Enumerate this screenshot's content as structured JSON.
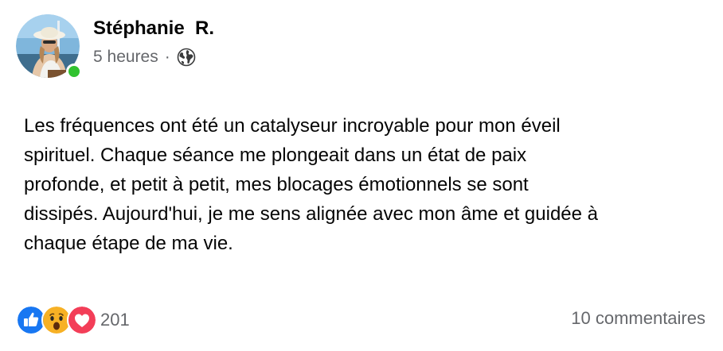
{
  "author": {
    "name": "Stéphanie  R.",
    "online": true
  },
  "meta": {
    "time": "5 heures",
    "separator": "·",
    "audience_icon": "globe-icon"
  },
  "post": {
    "lines": [
      "Les fréquences ont été un catalyseur incroyable pour mon éveil",
      "spirituel. Chaque séance me plongeait dans un état de paix",
      "profonde, et petit à petit, mes blocages émotionnels se sont",
      "dissipés. Aujourd'hui, je me sens alignée avec mon âme et guidée à",
      "chaque étape de ma vie."
    ]
  },
  "footer": {
    "reactions": [
      "like-icon",
      "wow-icon",
      "love-icon"
    ],
    "reaction_count": "201",
    "comments": "10 commentaires"
  },
  "colors": {
    "like": "#1877f2",
    "wow": "#f7b125",
    "love": "#f33e58",
    "online": "#31c22f",
    "secondary_text": "#65676b"
  }
}
